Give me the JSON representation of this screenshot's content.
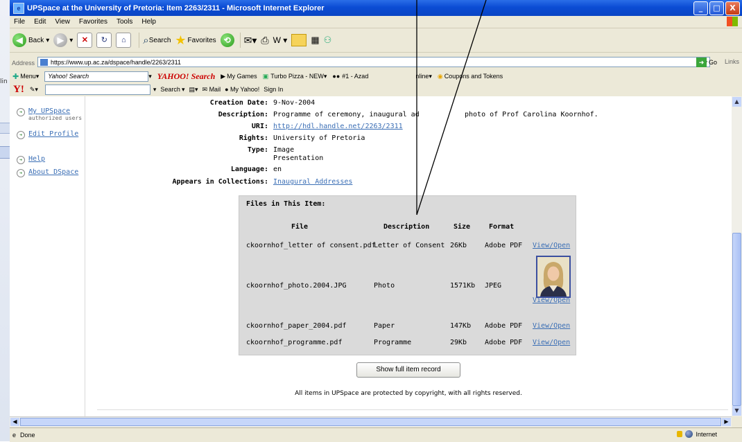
{
  "background": {
    "fragment": "lin"
  },
  "window": {
    "title": "UPSpace at the University of Pretoria: Item 2263/2311 - Microsoft Internet Explorer",
    "buttons": {
      "minimize": "_",
      "maximize": "□",
      "close": "X"
    }
  },
  "menu": {
    "items": [
      "File",
      "Edit",
      "View",
      "Favorites",
      "Tools",
      "Help"
    ]
  },
  "toolbar": {
    "back": "Back",
    "search": "Search",
    "favorites": "Favorites"
  },
  "address": {
    "label": "Address",
    "url": "https://www.up.ac.za/dspace/handle/2263/2311",
    "go": "Go",
    "links": "Links"
  },
  "yahoo": {
    "menu": "Menu",
    "search_box": "Yahoo! Search",
    "search_brand": "YAHOO! Search",
    "my_games": "My Games",
    "turbo_pizza": "Turbo Pizza - NEW",
    "azad": "#1 - Azad",
    "nline": "nline",
    "coupons": "Coupons and Tokens",
    "logo": "Y!",
    "search_btn": "Search",
    "mail": "Mail",
    "my_yahoo": "My Yahoo!",
    "sign_in": "Sign In"
  },
  "sidebar": {
    "items": [
      {
        "label": "My UPSpace",
        "sub": "authorized users"
      },
      {
        "label": "Edit Profile"
      },
      {
        "label": "Help"
      },
      {
        "label": "About DSpace"
      }
    ]
  },
  "metadata": [
    {
      "key": "Creation Date:",
      "value": "9-Nov-2004"
    },
    {
      "key": "Description:",
      "value": "Programme of ceremony, inaugural ad",
      "value2": "photo of Prof Carolina Koornhof."
    },
    {
      "key": "URI:",
      "value": "http://hdl.handle.net/2263/2311",
      "link": true
    },
    {
      "key": "Rights:",
      "value": "University of Pretoria"
    },
    {
      "key": "Type:",
      "value": "Image",
      "value2": "Presentation"
    },
    {
      "key": "Language:",
      "value": "en"
    },
    {
      "key": "Appears in Collections:",
      "value": "Inaugural Addresses",
      "link": true
    }
  ],
  "files": {
    "title": "Files in This Item:",
    "headers": [
      "File",
      "Description",
      "Size",
      "Format"
    ],
    "rows": [
      {
        "file": "ckoornhof_letter of consent.pdf",
        "description": "Letter of Consent",
        "size": "26Kb",
        "format": "Adobe PDF",
        "action": "View/Open"
      },
      {
        "file": "ckoornhof_photo.2004.JPG",
        "description": "Photo",
        "size": "1571Kb",
        "format": "JPEG",
        "action": "View/Open"
      },
      {
        "file": "ckoornhof_paper_2004.pdf",
        "description": "Paper",
        "size": "147Kb",
        "format": "Adobe PDF",
        "action": "View/Open"
      },
      {
        "file": "ckoornhof_programme.pdf",
        "description": "Programme",
        "size": "29Kb",
        "format": "Adobe PDF",
        "action": "View/Open"
      }
    ]
  },
  "show_full": "Show full item record",
  "copyright": "All items in UPSpace are protected by copyright, with all rights reserved.",
  "status": {
    "done": "Done",
    "zone": "Internet"
  }
}
